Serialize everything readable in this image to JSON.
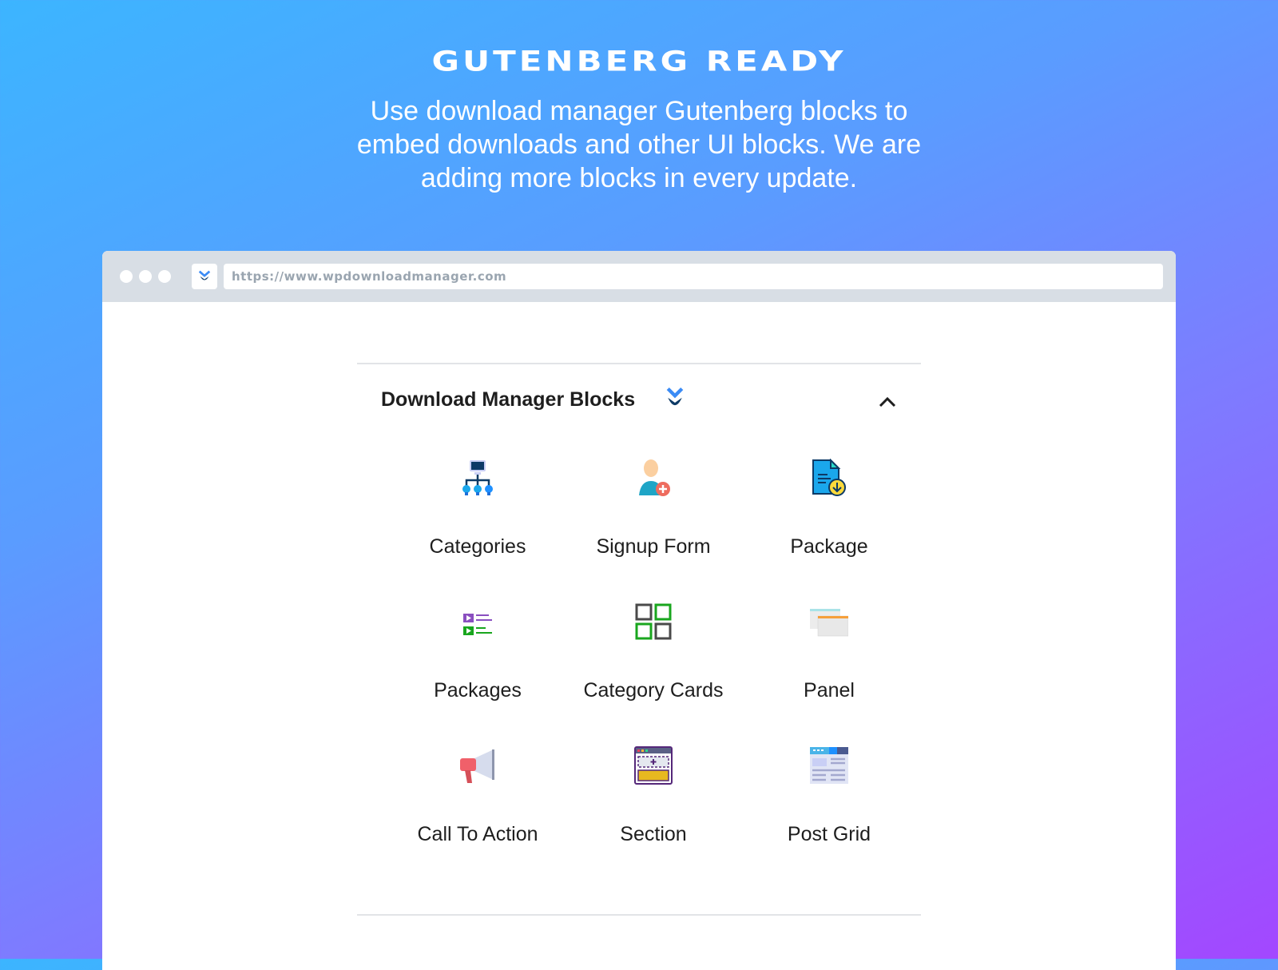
{
  "hero": {
    "title": "GUTENBERG READY",
    "subtitle": "Use download manager Gutenberg blocks to embed downloads and other UI blocks. We are adding more blocks in every update."
  },
  "browser": {
    "url": "https://www.wpdownloadmanager.com",
    "favicon": "wpdm-logo-icon"
  },
  "panel": {
    "title": "Download Manager Blocks",
    "collapse_icon": "chevron-up-icon",
    "blocks": [
      {
        "label": "Categories",
        "icon": "hierarchy-icon"
      },
      {
        "label": "Signup Form",
        "icon": "user-add-icon"
      },
      {
        "label": "Package",
        "icon": "file-download-icon"
      },
      {
        "label": "Packages",
        "icon": "list-play-icon"
      },
      {
        "label": "Category Cards",
        "icon": "grid-icon"
      },
      {
        "label": "Panel",
        "icon": "panel-icon"
      },
      {
        "label": "Call To Action",
        "icon": "megaphone-icon"
      },
      {
        "label": "Section",
        "icon": "section-icon"
      },
      {
        "label": "Post Grid",
        "icon": "post-grid-icon"
      }
    ]
  },
  "colors": {
    "gradient_start": "#3cb5ff",
    "gradient_end": "#a347ff",
    "url_bar": "#d8dee5",
    "brand_blue": "#3b8bf5",
    "brand_navy": "#0d3a66"
  }
}
